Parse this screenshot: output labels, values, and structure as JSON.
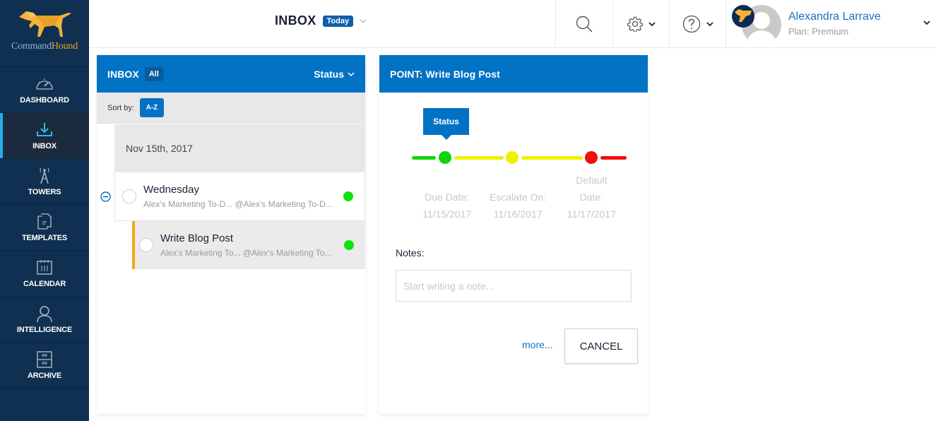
{
  "app": {
    "name_part1": "Command",
    "name_part2": "Hound"
  },
  "sidebar": {
    "items": [
      {
        "label": "DASHBOARD",
        "icon": "gauge-icon",
        "active": false
      },
      {
        "label": "INBOX",
        "icon": "inbox-download-icon",
        "active": true
      },
      {
        "label": "TOWERS",
        "icon": "tower-icon",
        "active": false
      },
      {
        "label": "TEMPLATES",
        "icon": "templates-icon",
        "active": false
      },
      {
        "label": "CALENDAR",
        "icon": "calendar-icon",
        "active": false
      },
      {
        "label": "INTELLIGENCE",
        "icon": "person-icon",
        "active": false
      },
      {
        "label": "ARCHIVE",
        "icon": "archive-cabinet-icon",
        "active": false
      }
    ]
  },
  "header": {
    "title": "INBOX",
    "filter_badge": "Today",
    "user": {
      "name": "Alexandra Larrave",
      "plan": "Plan: Premium"
    }
  },
  "inbox_panel": {
    "title": "INBOX",
    "filter_badge": "All",
    "status_dropdown": "Status",
    "sort_label": "Sort by:",
    "sort_button": "A-Z",
    "date_group": "Nov 15th, 2017",
    "items": [
      {
        "title": "Wednesday",
        "subtitle": "Alex's Marketing To-D... @Alex's Marketing To-D...",
        "status_color": "#0ee10e"
      },
      {
        "title": "Write Blog Post",
        "subtitle": "Alex's Marketing To... @Alex's Marketing To...",
        "status_color": "#0ee10e",
        "selected": true
      }
    ]
  },
  "point_panel": {
    "title": "POINT: Write Blog Post",
    "status_tooltip": "Status",
    "status_colors": {
      "green": "#10d410",
      "yellow": "#eef200",
      "red": "#f40b0b"
    },
    "dates": [
      {
        "label_line1": "Due Date:",
        "label_line2": "",
        "value": "11/15/2017"
      },
      {
        "label_line1": "Escalate On:",
        "label_line2": "",
        "value": "11/16/2017"
      },
      {
        "label_line1": "Default",
        "label_line2": "Date:",
        "value": "11/17/2017"
      }
    ],
    "notes_label": "Notes:",
    "notes_value": "",
    "notes_placeholder": "Start writing a note...",
    "more_link": "more...",
    "cancel_button": "CANCEL"
  }
}
